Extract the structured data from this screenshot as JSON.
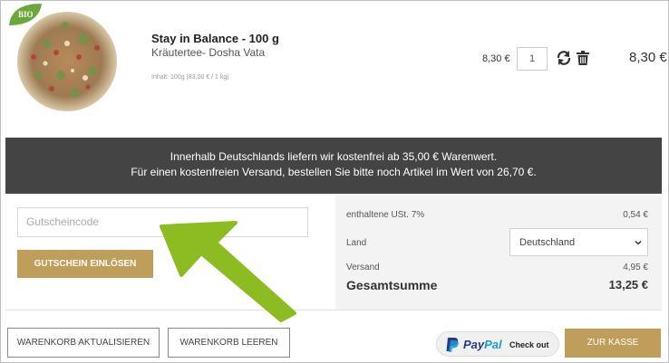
{
  "product": {
    "badge": "BIO",
    "name": "Stay in Balance - 100 g",
    "subtitle": "Kräutertee- Dosha Vata",
    "info": "Inhalt: 100g (83,00 € / 1 kg)",
    "unit_price": "8,30 €",
    "quantity": "1",
    "line_total": "8,30 €",
    "icons": [
      "refresh-icon",
      "trash-icon"
    ]
  },
  "shipping_banner": {
    "line1": "Innerhalb Deutschlands liefern wir kostenfrei ab 35,00 € Warenwert.",
    "line2": "Für einen kostenfreien Versand, bestellen Sie bitte noch Artikel im Wert von 26,70 €."
  },
  "coupon": {
    "placeholder": "Gutscheincode",
    "button": "GUTSCHEIN EINLÖSEN"
  },
  "summary": {
    "tax_label": "enthaltene USt. 7%",
    "tax_value": "0,54 €",
    "country_label": "Land",
    "country_value": "Deutschland",
    "shipping_label": "Versand",
    "shipping_value": "4,95 €",
    "total_label": "Gesamtsumme",
    "total_value": "13,25 €"
  },
  "actions": {
    "update_cart": "WARENKORB AKTUALISIEREN",
    "clear_cart": "WARENKORB LEEREN",
    "paypal_pay": "Pay",
    "paypal_pal": "Pal",
    "paypal_checkout": "Check out",
    "checkout": "ZUR KASSE"
  },
  "colors": {
    "accent_gold": "#bf9d5a",
    "banner_bg": "#444444",
    "arrow_green": "#8dbb22"
  }
}
